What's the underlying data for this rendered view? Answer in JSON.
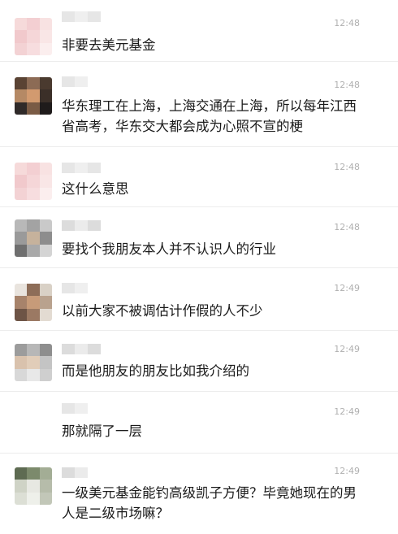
{
  "messages": [
    {
      "time": "12:48",
      "text": "非要去美元基金"
    },
    {
      "time": "12:48",
      "text": "华东理工在上海，上海交通在上海，所以每年江西省高考，华东交大都会成为心照不宣的梗"
    },
    {
      "time": "12:48",
      "text": "这什么意思"
    },
    {
      "time": "12:48",
      "text": "要找个我朋友本人并不认识人的行业"
    },
    {
      "time": "12:49",
      "text": "以前大家不被调估计作假的人不少"
    },
    {
      "time": "12:49",
      "text": "而是他朋友的朋友比如我介绍的"
    },
    {
      "time": "12:49",
      "text": "那就隔了一层"
    },
    {
      "time": "12:49",
      "text": "一级美元基金能钓高级凯子方便？毕竟她现在的男人是二级市场嘛？"
    }
  ]
}
